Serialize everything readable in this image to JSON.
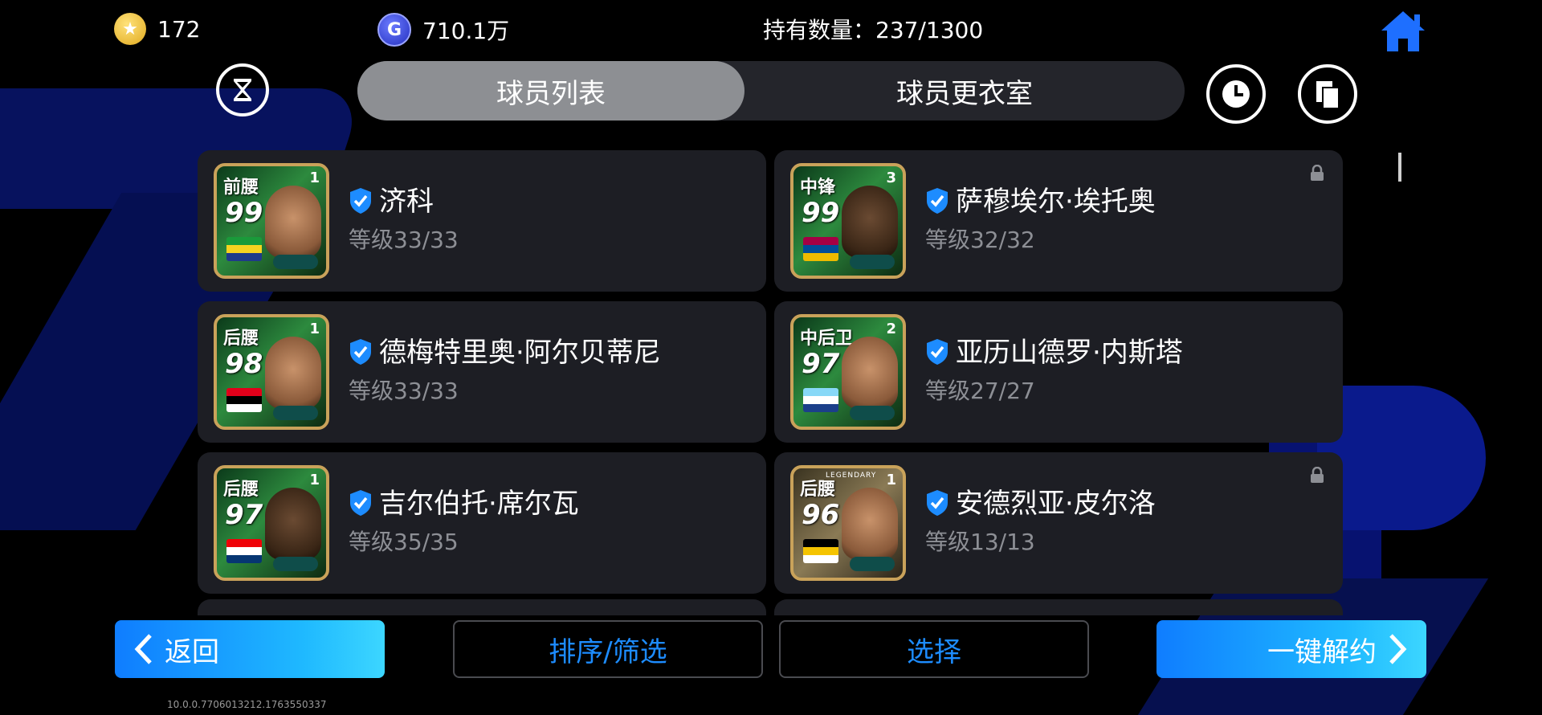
{
  "header": {
    "coins": "172",
    "gp": "710.1万",
    "holdings_label": "持有数量：237/1300"
  },
  "tabs": [
    {
      "label": "球员列表",
      "active": true
    },
    {
      "label": "球员更衣室",
      "active": false
    }
  ],
  "players": [
    {
      "position": "前腰",
      "rating": "99",
      "rank": "1",
      "name": "济科",
      "level": "等级33/33",
      "locked": false,
      "card": "green",
      "flag_colors": [
        "#1a9a3a",
        "#f6d320",
        "#1f3a8a"
      ]
    },
    {
      "position": "中锋",
      "rating": "99",
      "rank": "3",
      "name": "萨穆埃尔·埃托奥",
      "level": "等级32/32",
      "locked": true,
      "card": "green",
      "flag_colors": [
        "#a50044",
        "#004d98",
        "#edbb00"
      ]
    },
    {
      "position": "后腰",
      "rating": "98",
      "rank": "1",
      "name": "德梅特里奥·阿尔贝蒂尼",
      "level": "等级33/33",
      "locked": false,
      "card": "green",
      "flag_colors": [
        "#e2001a",
        "#000000",
        "#ffffff"
      ]
    },
    {
      "position": "中后卫",
      "rating": "97",
      "rank": "2",
      "name": "亚历山德罗·内斯塔",
      "level": "等级27/27",
      "locked": false,
      "card": "green",
      "flag_colors": [
        "#87d8f7",
        "#ffffff",
        "#1b3f8a"
      ]
    },
    {
      "position": "后腰",
      "rating": "97",
      "rank": "1",
      "name": "吉尔伯托·席尔瓦",
      "level": "等级35/35",
      "locked": false,
      "card": "green",
      "flag_colors": [
        "#ef0107",
        "#ffffff",
        "#063672"
      ]
    },
    {
      "position": "后腰",
      "rating": "96",
      "rank": "1",
      "name": "安德烈亚·皮尔洛",
      "level": "等级13/13",
      "locked": true,
      "card": "legend",
      "legend_label": "LEGENDARY",
      "flag_colors": [
        "#000000",
        "#f5c400",
        "#ffffff"
      ]
    }
  ],
  "buttons": {
    "back": "返回",
    "sort_filter": "排序/筛选",
    "select": "选择",
    "release_all": "一键解约"
  },
  "version": "10.0.0.7706013212.1763550337",
  "colors": {
    "accent_blue": "#1d8cff",
    "card_bg": "#1d1e24",
    "tab_active": "#8d8f93"
  },
  "icons": {
    "coin": "star-coin-icon",
    "gp": "gp-icon",
    "home": "home-icon",
    "hourglass": "hourglass-icon",
    "clock": "clock-icon",
    "copy": "copy-icon",
    "verified": "shield-check-icon",
    "lock": "lock-icon"
  }
}
